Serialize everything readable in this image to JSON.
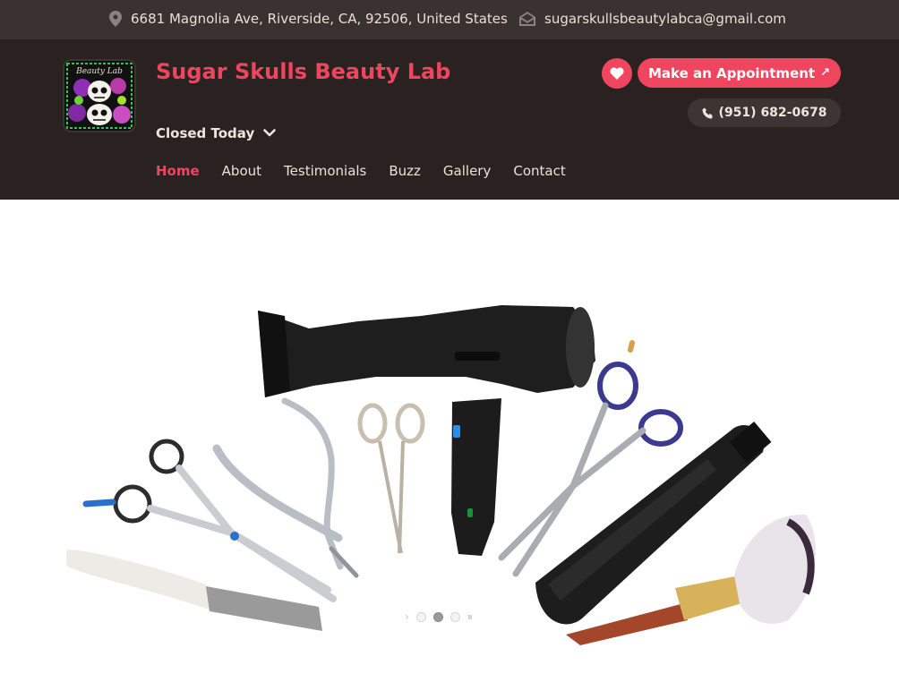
{
  "topbar": {
    "address": "6681 Magnolia Ave, Riverside, CA, 92506, United States",
    "email": "sugarskullsbeautylabca@gmail.com",
    "address_icon": "map-pin-icon",
    "email_icon": "envelope-icon"
  },
  "header": {
    "brand_name": "Sugar Skulls Beauty Lab",
    "logo_text": "Beauty Lab",
    "hours_status": "Closed Today",
    "appointment_label": "Make an Appointment",
    "phone": "(951) 682-0678",
    "accent_color": "#f0455f",
    "header_bg": "#2a2220"
  },
  "nav": {
    "items": [
      {
        "label": "Home",
        "active": true
      },
      {
        "label": "About"
      },
      {
        "label": "Testimonials"
      },
      {
        "label": "Buzz"
      },
      {
        "label": "Gallery"
      },
      {
        "label": "Contact"
      }
    ]
  },
  "slider": {
    "slide_count": 3,
    "active_slide": 2,
    "image_description_icon": "salon-tools-image"
  }
}
